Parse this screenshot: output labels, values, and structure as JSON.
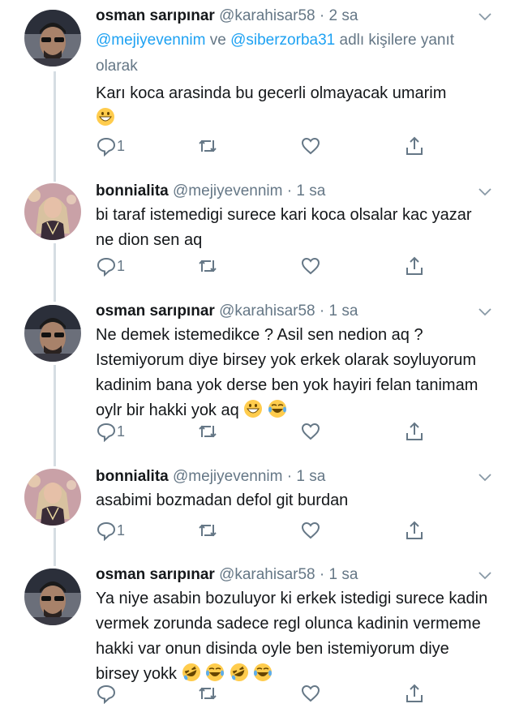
{
  "tweets": [
    {
      "name": "osman sarıpınar",
      "handle": "@karahisar58",
      "sep": "·",
      "time": "2 sa",
      "reply_to": {
        "mention1": "@mejiyevennim",
        "connector": " ve ",
        "mention2": "@siberzorba31",
        "suffix": " adlı kişilere yanıt olarak"
      },
      "text": "Karı koca arasinda bu gecerli olmayacak umarim",
      "emojis": [
        "grinning-face-emoji"
      ],
      "reply_count": "1",
      "avatar": "osman-avatar"
    },
    {
      "name": "bonnialita",
      "handle": "@mejiyevennim",
      "sep": "·",
      "time": "1 sa",
      "text": "bi taraf istemedigi surece kari koca olsalar kac yazar ne dion sen aq",
      "emojis": [],
      "reply_count": "1",
      "avatar": "bonnialita-avatar"
    },
    {
      "name": "osman sarıpınar",
      "handle": "@karahisar58",
      "sep": "·",
      "time": "1 sa",
      "text": "Ne demek istemedikce ? Asil sen nedion aq ? Istemiyorum diye birsey yok erkek olarak soyluyorum kadinim bana yok derse ben yok hayiri felan tanimam oylr bir hakki yok aq",
      "emojis": [
        "grinning-face-emoji",
        "tears-of-joy-emoji"
      ],
      "reply_count": "1",
      "avatar": "osman-avatar"
    },
    {
      "name": "bonnialita",
      "handle": "@mejiyevennim",
      "sep": "·",
      "time": "1 sa",
      "text": "asabimi bozmadan defol git burdan",
      "emojis": [],
      "reply_count": "1",
      "avatar": "bonnialita-avatar"
    },
    {
      "name": "osman sarıpınar",
      "handle": "@karahisar58",
      "sep": "·",
      "time": "1 sa",
      "text": "Ya niye asabin bozuluyor ki erkek istedigi surece kadin vermek zorunda sadece regl olunca kadinin vermeme hakki var onun disinda oyle ben istemiyorum diye birsey yokk",
      "emojis": [
        "rolling-laughing-emoji",
        "tears-of-joy-emoji",
        "rolling-laughing-emoji",
        "tears-of-joy-emoji"
      ],
      "reply_count": "",
      "avatar": "osman-avatar"
    }
  ],
  "colors": {
    "text": "#14171a",
    "secondary": "#657786",
    "link": "#1da1f2",
    "thread_line": "#d6dde3"
  },
  "icons": [
    "reply-icon",
    "retweet-icon",
    "like-icon",
    "share-icon",
    "chevron-down-icon"
  ]
}
